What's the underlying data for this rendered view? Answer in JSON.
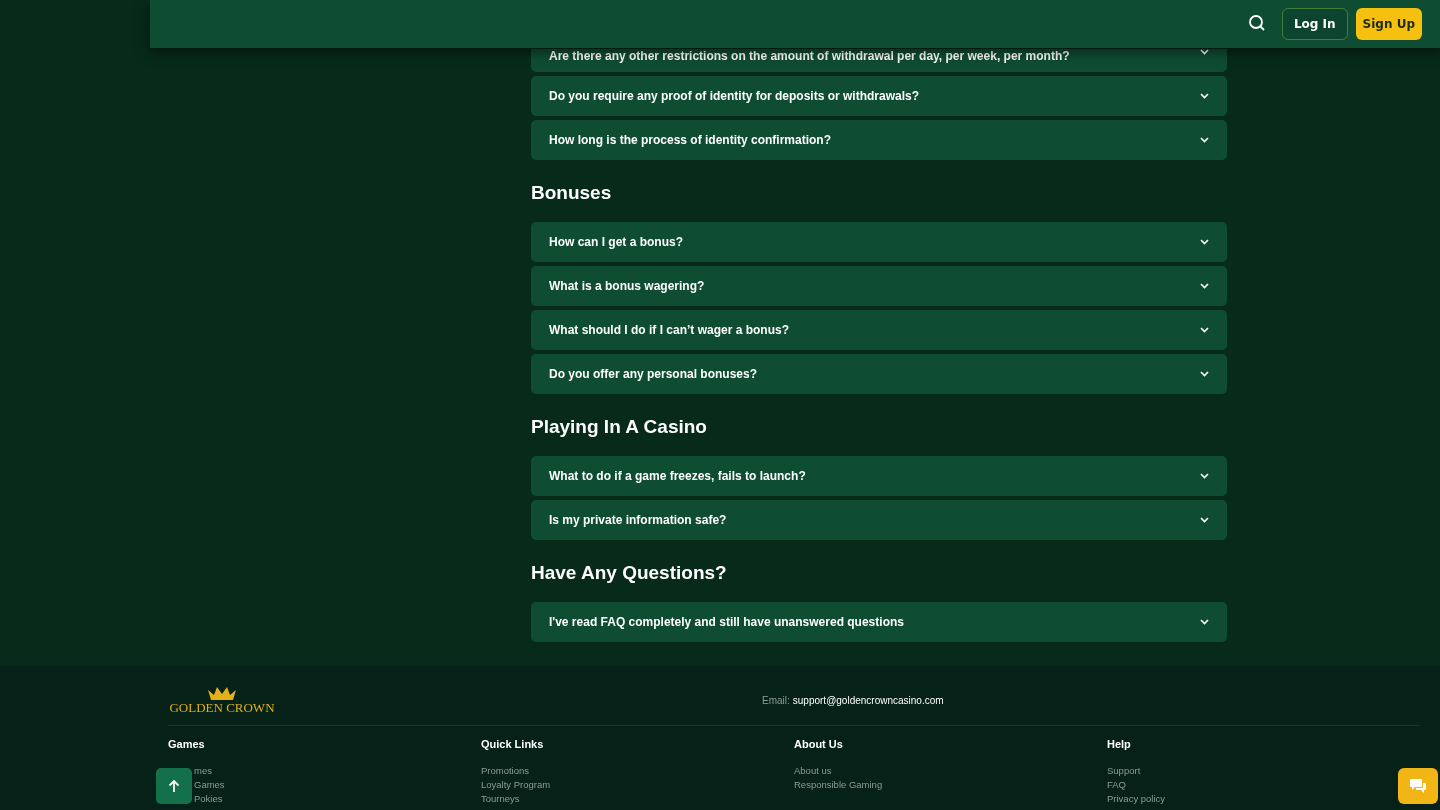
{
  "header": {
    "login": "Log In",
    "signup": "Sign Up"
  },
  "sections": [
    {
      "items": [
        {
          "question": "Are there any other restrictions on the amount of withdrawal per day, per week, per month?",
          "expanded": false
        },
        {
          "question": "Do you require any proof of identity for deposits or withdrawals?",
          "expanded": false
        },
        {
          "question": "How long is the process of identity confirmation?",
          "expanded": false
        }
      ]
    },
    {
      "title": "Bonuses",
      "items": [
        {
          "question": "How can I get a bonus?",
          "expanded": false
        },
        {
          "question": "What is a bonus wagering?",
          "expanded": false
        },
        {
          "question": "What should I do if I can’t wager a bonus?",
          "expanded": false
        },
        {
          "question": "Do you offer any personal bonuses?",
          "expanded": false
        }
      ]
    },
    {
      "title": "Playing In A Casino",
      "items": [
        {
          "question": "What to do if a game freezes, fails to launch?",
          "expanded": false
        },
        {
          "question": "Is my private information safe?",
          "expanded": false
        }
      ]
    },
    {
      "title": "Have Any Questions?",
      "items": [
        {
          "question": "I've read FAQ completely and still have unanswered questions",
          "expanded": false
        }
      ]
    }
  ],
  "footer": {
    "logo": "GOLDEN CROWN",
    "email_label": "Email:",
    "email": "support@goldencrowncasino.com",
    "columns": [
      {
        "title": "Games",
        "links": [
          "mes",
          "Games",
          "Pokies"
        ]
      },
      {
        "title": "Quick Links",
        "links": [
          "Promotions",
          "Loyalty Program",
          "Tourneys"
        ]
      },
      {
        "title": "About Us",
        "links": [
          "About us",
          "Responsible Gaming"
        ]
      },
      {
        "title": "Help",
        "links": [
          "Support",
          "FAQ",
          "Privacy policy"
        ]
      }
    ]
  }
}
